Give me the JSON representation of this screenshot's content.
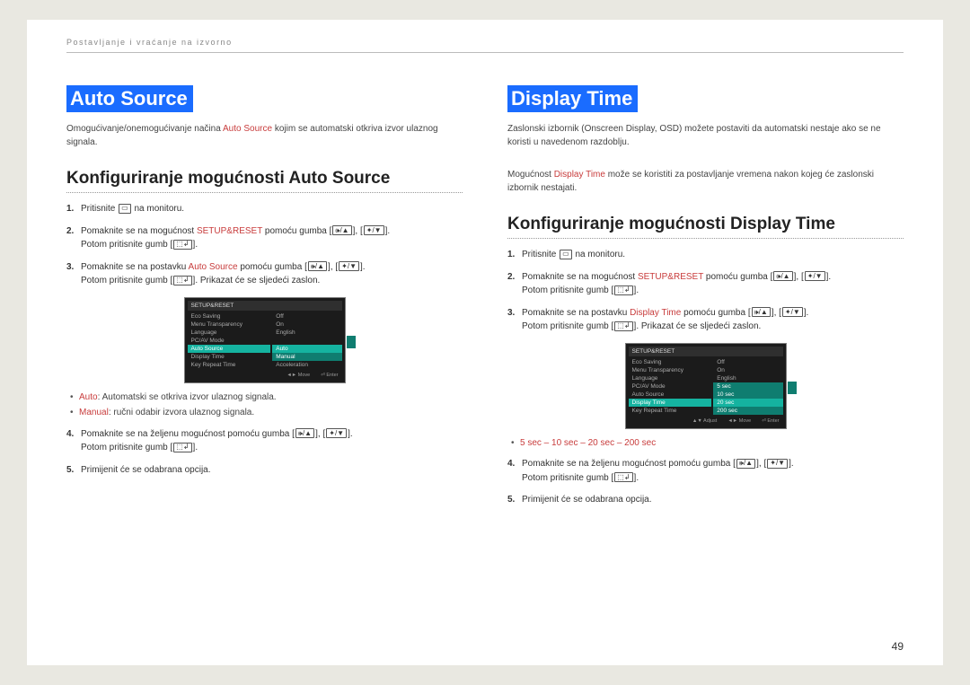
{
  "breadcrumb": "Postavljanje i vraćanje na izvorno",
  "page_number": "49",
  "left": {
    "title": "Auto Source",
    "intro_pre": "Omogućivanje/onemogućivanje načina ",
    "intro_red": "Auto Source",
    "intro_post": " kojim se automatski otkriva izvor ulaznog signala.",
    "subhead": "Konfiguriranje mogućnosti Auto Source",
    "steps": {
      "s1_a": "Pritisnite ",
      "s1_b": " na monitoru.",
      "s2_a": "Pomaknite se na mogućnost ",
      "s2_red": "SETUP&RESET",
      "s2_b": " pomoću gumba ",
      "s2_after": "Potom pritisnite gumb ",
      "s2_end": ".",
      "s3_a": "Pomaknite se na postavku ",
      "s3_red": "Auto Source",
      "s3_b": " pomoću gumba ",
      "s3_after": "Potom pritisnite gumb ",
      "s3_end": ". Prikazat će se sljedeći zaslon.",
      "s4_a": "Pomaknite se na željenu mogućnost pomoću gumba ",
      "s4_after": "Potom pritisnite gumb ",
      "s4_end": ".",
      "s5": "Primijenit će se odabrana opcija."
    },
    "bullets": {
      "b1_red": "Auto",
      "b1_rest": ": Automatski se otkriva izvor ulaznog signala.",
      "b2_red": "Manual",
      "b2_rest": ": ručni odabir izvora ulaznog signala."
    },
    "osd": {
      "title": "SETUP&RESET",
      "rows": [
        "Eco Saving",
        "Menu Transparency",
        "Language",
        "PC/AV Mode",
        "Auto Source",
        "Display Time",
        "Key Repeat Time"
      ],
      "vals": [
        "Off",
        "On",
        "English",
        "",
        "",
        "",
        ""
      ],
      "hl_label": "Auto",
      "hl2_label": "Manual",
      "hl2_sub": "Acceleration",
      "foot": [
        "◄► Move",
        "⏎ Enter"
      ]
    }
  },
  "right": {
    "title": "Display Time",
    "intro": "Zaslonski izbornik (Onscreen Display, OSD) možete postaviti da automatski nestaje ako se ne koristi u navedenom razdoblju.",
    "intro2_a": "Mogućnost ",
    "intro2_red": "Display Time",
    "intro2_b": " može se koristiti za postavljanje vremena nakon kojeg će zaslonski izbornik nestajati.",
    "subhead": "Konfiguriranje mogućnosti Display Time",
    "steps": {
      "s1_a": "Pritisnite ",
      "s1_b": " na monitoru.",
      "s2_a": "Pomaknite se na mogućnost ",
      "s2_red": "SETUP&RESET",
      "s2_b": " pomoću gumba ",
      "s2_after": "Potom pritisnite gumb ",
      "s2_end": ".",
      "s3_a": "Pomaknite se na postavku ",
      "s3_red": "Display Time",
      "s3_b": " pomoću gumba ",
      "s3_after": "Potom pritisnite gumb ",
      "s3_end": ". Prikazat će se sljedeći zaslon.",
      "s4_a": "Pomaknite se na željenu mogućnost pomoću gumba ",
      "s4_after": "Potom pritisnite gumb ",
      "s4_end": ".",
      "s5": "Primijenit će se odabrana opcija."
    },
    "bullet_red": "5 sec – 10 sec – 20 sec – 200 sec",
    "osd": {
      "title": "SETUP&RESET",
      "rows": [
        "Eco Saving",
        "Menu Transparency",
        "Language",
        "PC/AV Mode",
        "Auto Source",
        "Display Time",
        "Key Repeat Time"
      ],
      "vals": [
        "Off",
        "On",
        "English",
        "",
        "",
        "",
        ""
      ],
      "hl_labels": [
        "5 sec",
        "10 sec",
        "20 sec",
        "200 sec"
      ],
      "foot": [
        "▲▼ Adjust",
        "◄► Move",
        "⏎ Enter"
      ]
    }
  }
}
